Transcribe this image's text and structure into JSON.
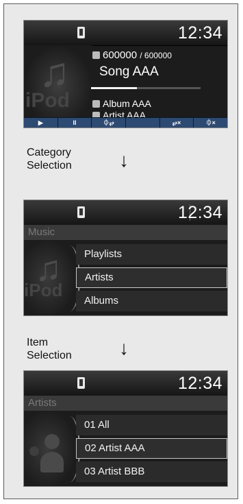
{
  "screen1": {
    "clock": "12:34",
    "track_number": "600000",
    "track_total": "/ 600000",
    "song": "Song AAA",
    "album": "Album AAA",
    "artist": "Artist AAA",
    "progress": 0.42,
    "brand_text": "iPod",
    "controls": [
      "▶",
      "II",
      "⏀⥂",
      "",
      "⥂×",
      "⏀×"
    ]
  },
  "caption1": {
    "line1": "Category",
    "line2": "Selection",
    "arrow": "↓"
  },
  "screen2": {
    "clock": "12:34",
    "title": "Music",
    "brand_text": "iPod",
    "items": [
      "Playlists",
      "Artists",
      "Albums"
    ],
    "selected_index": 1
  },
  "caption2": {
    "line1": "Item",
    "line2": "Selection",
    "arrow": "↓"
  },
  "screen3": {
    "clock": "12:34",
    "title": "Artists",
    "items": [
      "01 All",
      "02 Artist AAA",
      "03 Artist BBB"
    ],
    "selected_index": 1
  },
  "colors": {
    "panel_bg": "#e9e9e9",
    "screen_bg": "#1c1c1c",
    "control_bar": "#2d4a72",
    "text": "#ffffff"
  }
}
